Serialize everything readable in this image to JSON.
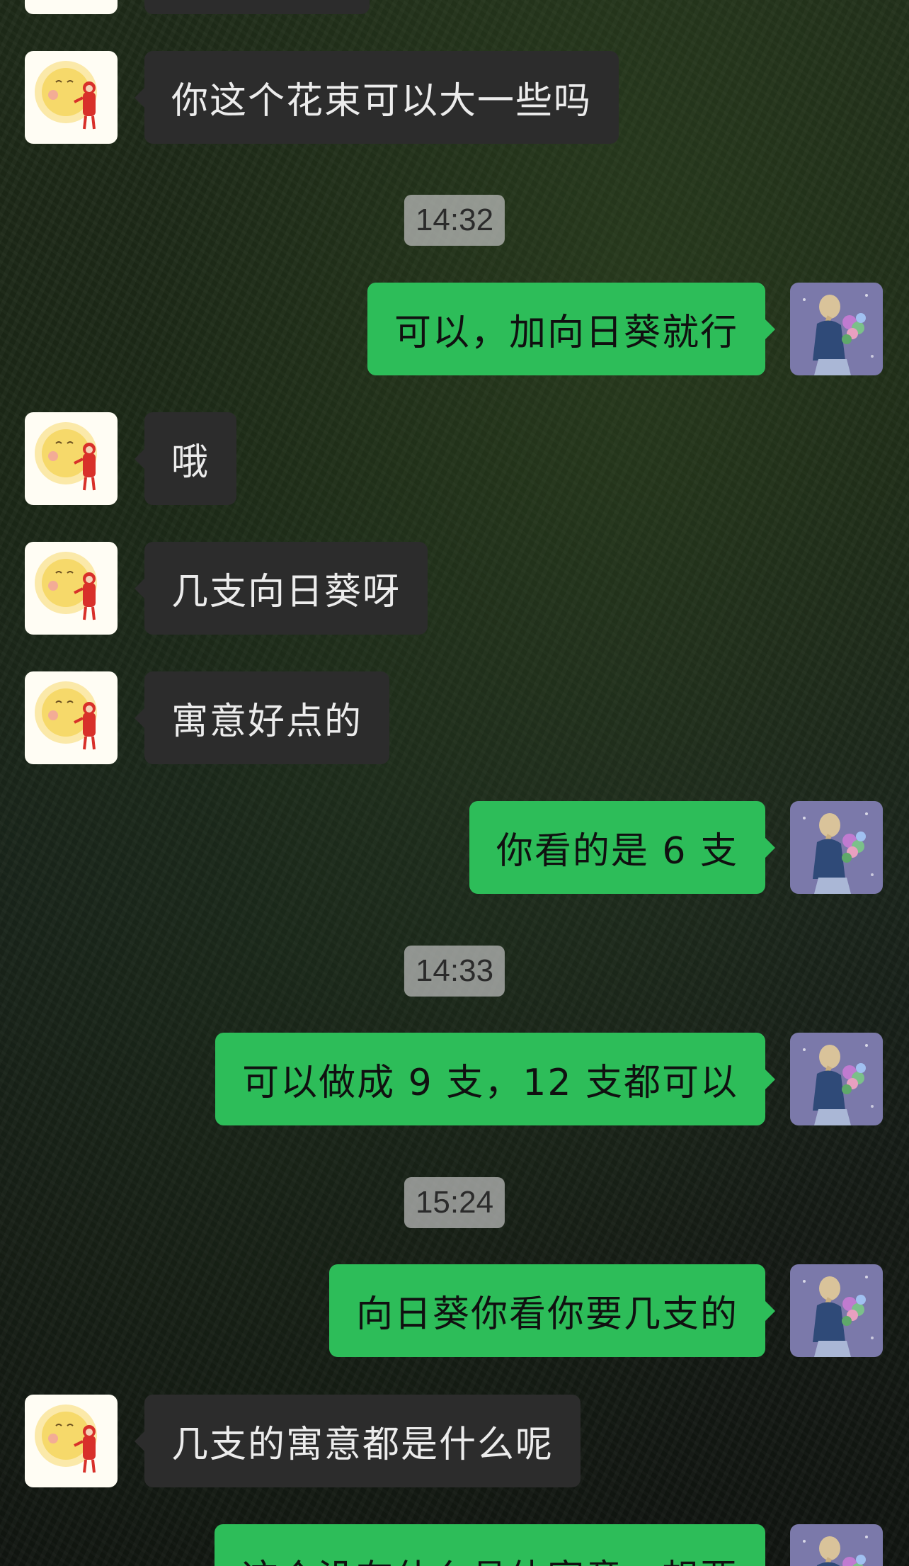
{
  "chat": {
    "messages": [
      {
        "side": "in",
        "text": "你这个花束可以大一些吗"
      },
      {
        "type": "time",
        "text": "14:32"
      },
      {
        "side": "out",
        "text": "可以，加向日葵就行"
      },
      {
        "side": "in",
        "text": "哦"
      },
      {
        "side": "in",
        "text": "几支向日葵呀"
      },
      {
        "side": "in",
        "text": "寓意好点的"
      },
      {
        "side": "out",
        "text": "你看的是 6 支"
      },
      {
        "type": "time",
        "text": "14:33"
      },
      {
        "side": "out",
        "text": "可以做成 9 支，12 支都可以"
      },
      {
        "type": "time",
        "text": "15:24"
      },
      {
        "side": "out",
        "text": "向日葵你看你要几支的"
      },
      {
        "side": "in",
        "text": "几支的寓意都是什么呢"
      },
      {
        "side": "out",
        "text": "这个没有什么具体寓意，想要"
      }
    ]
  },
  "avatars": {
    "contact": "sun-girl-avatar",
    "self": "flower-girl-avatar"
  },
  "colors": {
    "incoming_bubble": "#2c2c2c",
    "outgoing_bubble": "#2dbd59",
    "timestamp_bg": "#bebebe"
  }
}
